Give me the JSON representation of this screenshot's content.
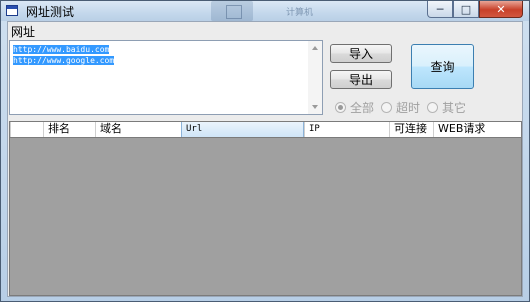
{
  "window": {
    "title": "网址测试"
  },
  "background": {
    "hint_text": "计算机"
  },
  "caption": {
    "minimize": "─",
    "maximize": "□",
    "close": "✕"
  },
  "url_section": {
    "label": "网址",
    "lines": [
      "http://www.baidu.com",
      "http://www.google.com"
    ]
  },
  "buttons": {
    "import": "导入",
    "export": "导出",
    "query": "查询"
  },
  "filters": {
    "all": "全部",
    "timeout": "超时",
    "other": "其它",
    "selected": "全部"
  },
  "grid": {
    "columns": [
      "",
      "排名",
      "域名",
      "Url",
      "IP",
      "可连接",
      "WEB请求"
    ],
    "active_column": "Url",
    "rows": []
  }
}
